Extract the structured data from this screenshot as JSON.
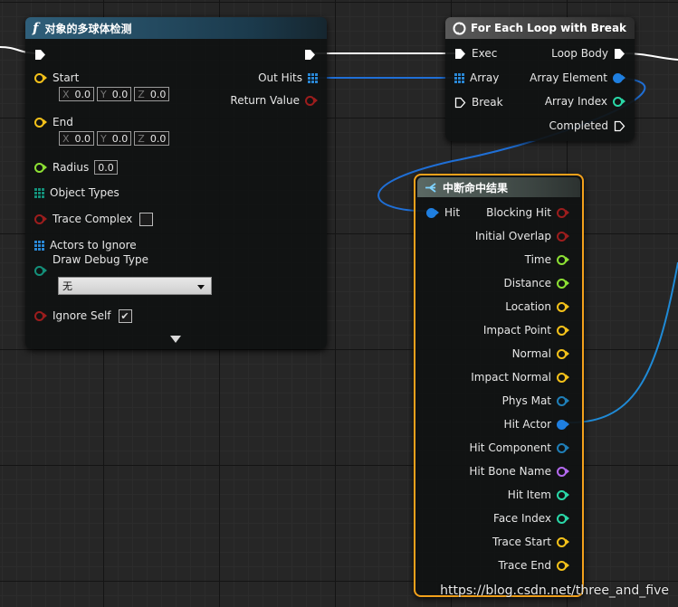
{
  "colors": {
    "func_header": "#2f5f7a",
    "loop_header": "#555555",
    "break_header": "#5b6964",
    "selection_border": "#f3a11b",
    "vector": "#f5c21a",
    "float": "#8de034",
    "bool": "#9c1d1d",
    "object": "#1f7fe0",
    "name": "#b46af0",
    "int": "#2ad8a8",
    "struct": "#1f7fb8",
    "exec": "#ffffff",
    "wire_blue": "#1f6fd6"
  },
  "sphere_trace_node": {
    "title": "对象的多球体检测",
    "title_icon": "function-f-icon",
    "pins": {
      "start": "Start",
      "end": "End",
      "radius": "Radius",
      "object_types": "Object Types",
      "trace_complex": "Trace Complex",
      "actors_to_ignore": "Actors to Ignore",
      "draw_debug_type": "Draw Debug Type",
      "ignore_self": "Ignore Self",
      "out_hits": "Out Hits",
      "return_value": "Return Value"
    },
    "start_vector": {
      "x_label": "X",
      "x": "0.0",
      "y_label": "Y",
      "y": "0.0",
      "z_label": "Z",
      "z": "0.0"
    },
    "end_vector": {
      "x_label": "X",
      "x": "0.0",
      "y_label": "Y",
      "y": "0.0",
      "z_label": "Z",
      "z": "0.0"
    },
    "radius_value": "0.0",
    "draw_debug_selected": "无",
    "trace_complex_checked": false,
    "ignore_self_checked": true
  },
  "foreach_node": {
    "title": "For Each Loop with Break",
    "title_icon": "loop-icon",
    "pins": {
      "exec": "Exec",
      "array": "Array",
      "break": "Break",
      "loop_body": "Loop Body",
      "array_element": "Array Element",
      "array_index": "Array Index",
      "completed": "Completed"
    }
  },
  "break_hit_node": {
    "title": "中断命中结果",
    "title_icon": "break-struct-icon",
    "input_pin": "Hit",
    "outputs": [
      {
        "label": "Blocking Hit",
        "type": "bool"
      },
      {
        "label": "Initial Overlap",
        "type": "bool"
      },
      {
        "label": "Time",
        "type": "float"
      },
      {
        "label": "Distance",
        "type": "float"
      },
      {
        "label": "Location",
        "type": "vector"
      },
      {
        "label": "Impact Point",
        "type": "vector"
      },
      {
        "label": "Normal",
        "type": "vector"
      },
      {
        "label": "Impact Normal",
        "type": "vector"
      },
      {
        "label": "Phys Mat",
        "type": "struct"
      },
      {
        "label": "Hit Actor",
        "type": "object"
      },
      {
        "label": "Hit Component",
        "type": "struct"
      },
      {
        "label": "Hit Bone Name",
        "type": "name"
      },
      {
        "label": "Hit Item",
        "type": "int"
      },
      {
        "label": "Face Index",
        "type": "int"
      },
      {
        "label": "Trace Start",
        "type": "vector"
      },
      {
        "label": "Trace End",
        "type": "vector"
      }
    ]
  },
  "watermark": "https://blog.csdn.net/three_and_five"
}
